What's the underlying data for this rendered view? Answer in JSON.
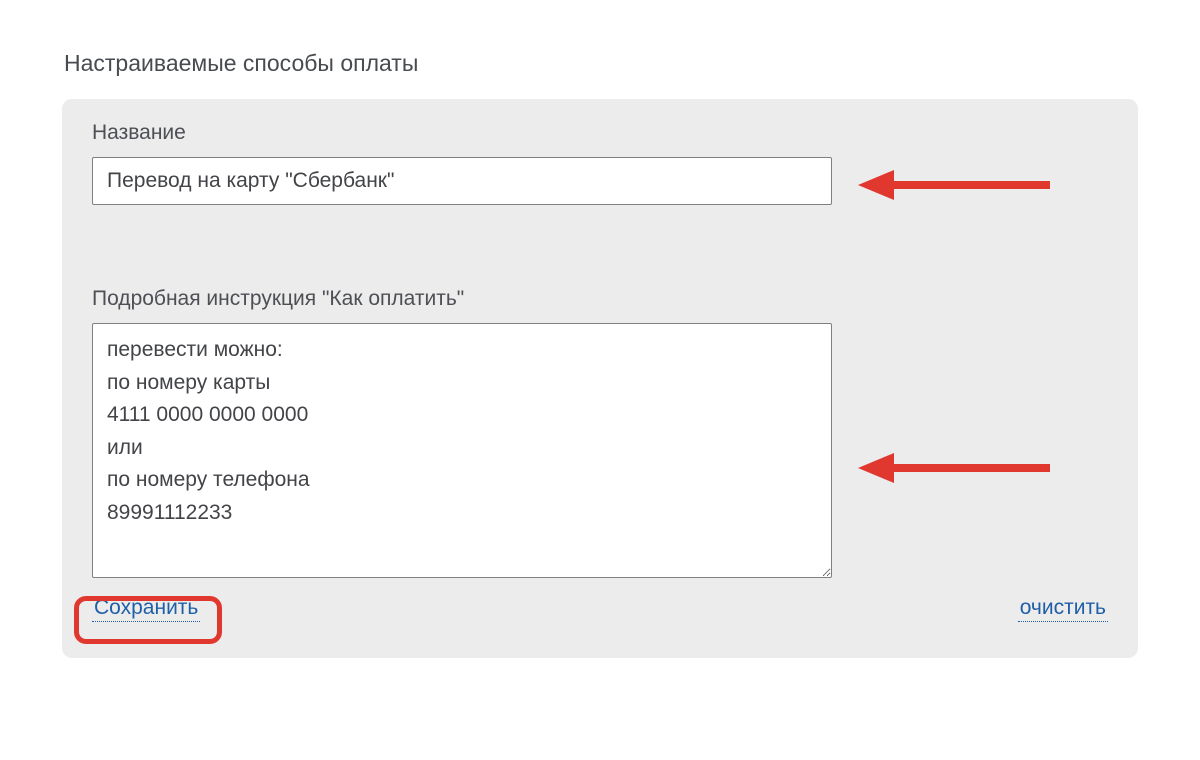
{
  "page_title": "Настраиваемые способы оплаты",
  "form": {
    "name_label": "Название",
    "name_value": "Перевод на карту \"Сбербанк\"",
    "instructions_label": "Подробная инструкция \"Как оплатить\"",
    "instructions_value": "перевести можно:\nпо номеру карты\n4111 0000 0000 0000\nили\nпо номеру телефона\n89991112233"
  },
  "actions": {
    "save": "Сохранить",
    "clear": "очистить"
  },
  "annotations": {
    "arrow_color": "#e0372f",
    "highlight_color": "#e0372f"
  }
}
